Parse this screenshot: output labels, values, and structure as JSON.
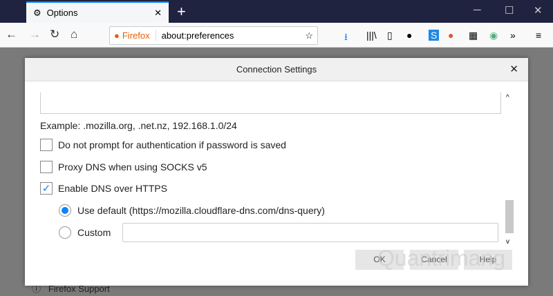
{
  "tab": {
    "title": "Options"
  },
  "url": {
    "brand": "Firefox",
    "address": "about:preferences"
  },
  "dialog": {
    "title": "Connection Settings",
    "example": "Example: .mozilla.org, .net.nz, 192.168.1.0/24",
    "opt_noprompt": "Do not prompt for authentication if password is saved",
    "opt_proxydns": "Proxy DNS when using SOCKS v5",
    "opt_doh": "Enable DNS over HTTPS",
    "doh_checked": true,
    "use_default": "Use default (https://mozilla.cloudflare-dns.com/dns-query)",
    "custom": "Custom",
    "custom_value": "",
    "ok": "OK",
    "cancel": "Cancel",
    "help": "Help"
  },
  "sidebar": {
    "support": "Firefox Support"
  },
  "watermark": "Quantrimang"
}
